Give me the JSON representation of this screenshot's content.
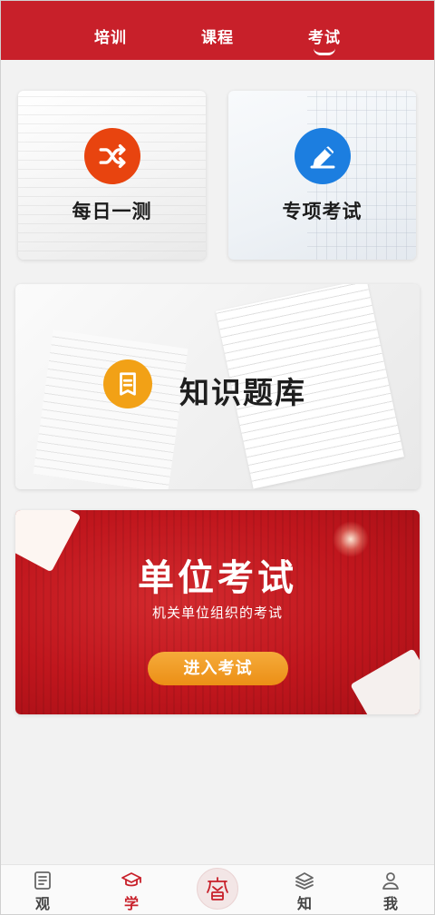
{
  "tabs": [
    {
      "label": "培训"
    },
    {
      "label": "课程"
    },
    {
      "label": "考试",
      "active": true
    }
  ],
  "cards": {
    "daily": {
      "title": "每日一测",
      "icon": "shuffle-icon",
      "color": "#e8440f"
    },
    "special": {
      "title": "专项考试",
      "icon": "pen-edit-icon",
      "color": "#1c7ee0"
    },
    "bank": {
      "title": "知识题库",
      "icon": "document-icon",
      "color": "#f2a116"
    },
    "unit": {
      "title": "单位考试",
      "subtitle": "机关单位组织的考试",
      "button_label": "进入考试",
      "accent": "#c0161d"
    }
  },
  "bottom_nav": [
    {
      "label": "观",
      "icon": "document-icon"
    },
    {
      "label": "学",
      "icon": "graduation-cap-icon",
      "active": true
    },
    {
      "label": "",
      "icon": "seal-logo-icon"
    },
    {
      "label": "知",
      "icon": "books-icon"
    },
    {
      "label": "我",
      "icon": "person-icon"
    }
  ]
}
